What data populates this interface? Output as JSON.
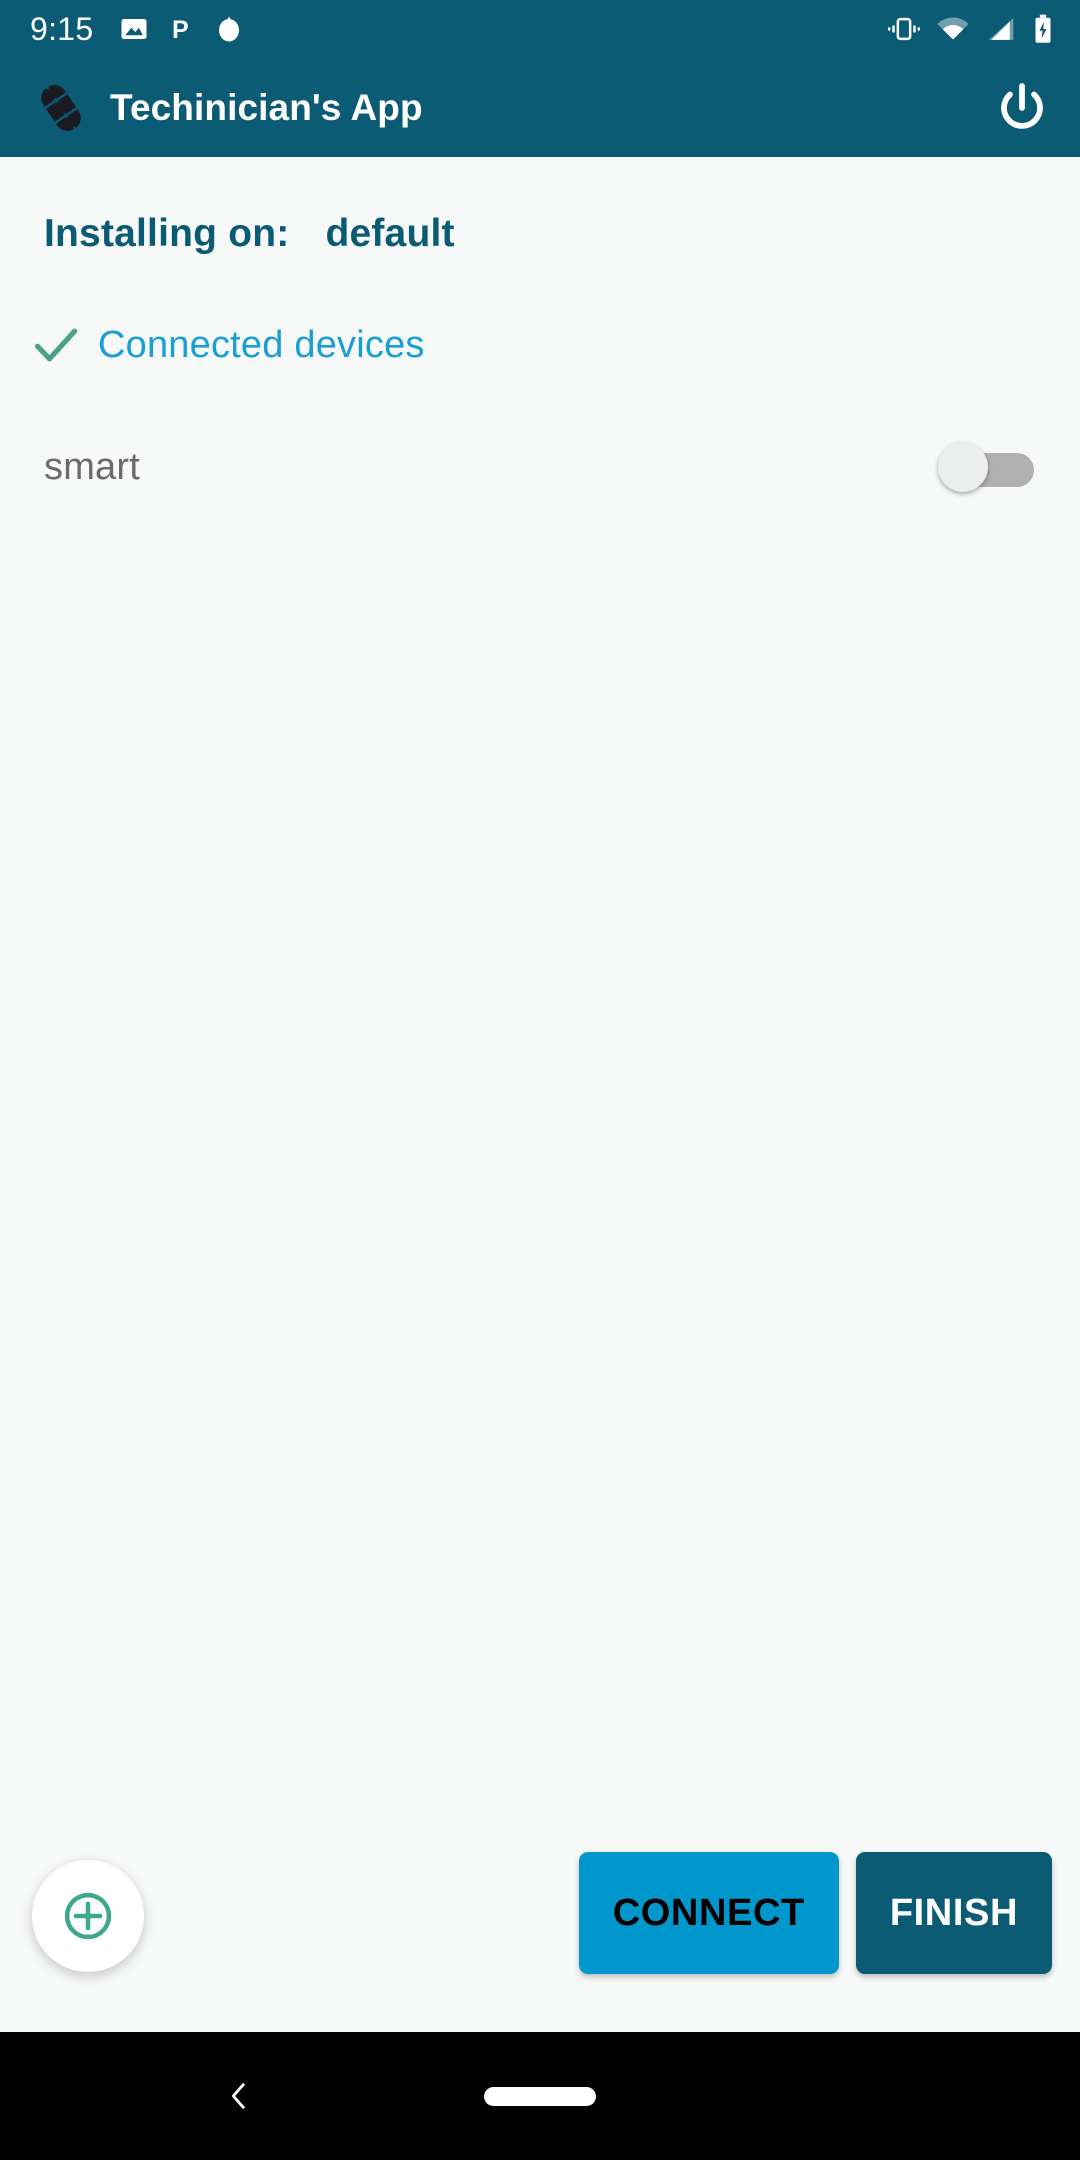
{
  "status_bar": {
    "clock": "9:15",
    "left_icons": [
      "image-icon",
      "p-icon",
      "droplet-icon"
    ],
    "right_icons": [
      "vibrate-icon",
      "wifi-icon",
      "cellular-signal-icon",
      "battery-charging-icon"
    ]
  },
  "app_bar": {
    "logo_icon": "app-logo-icon",
    "title": "Techinician's App",
    "power_icon": "power-icon"
  },
  "content": {
    "install_label": "Installing on:",
    "install_value": "default",
    "section": {
      "check_icon": "check-icon",
      "label": "Connected devices"
    },
    "devices": [
      {
        "name": "smart",
        "toggle_state": "off"
      }
    ]
  },
  "bottom_bar": {
    "fab_icon": "add-circle-icon",
    "connect_label": "CONNECT",
    "finish_label": "FINISH"
  },
  "nav_bar": {
    "back_icon": "back-chevron-icon",
    "home_icon": "home-pill-icon"
  },
  "colors": {
    "primary": "#0b5b75",
    "accent_blue": "#1a9fd4",
    "connect_blue": "#0098cc",
    "check_green": "#4aa47f",
    "fab_green": "#3da98a",
    "background": "#f7f8f8",
    "device_text": "#6b6b6b",
    "toggle_track_off": "#b0b0b0"
  }
}
